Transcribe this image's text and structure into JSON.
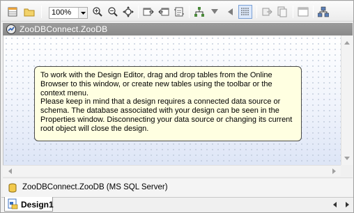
{
  "toolbar": {
    "zoom_value": "100%",
    "buttons": [
      "new-table-icon",
      "new-folder-icon",
      "zoom-in-icon",
      "zoom-out-icon",
      "fit-to-window-icon",
      "insert-table-icon",
      "remove-table-icon",
      "refresh-layout-icon",
      "hierarchy-icon",
      "arrow-down-icon",
      "arrow-left-icon",
      "grid-icon",
      "export-icon",
      "document-icon",
      "window-icon",
      "network-icon"
    ]
  },
  "title_bar": {
    "title": "ZooDBConnect.ZooDB"
  },
  "canvas": {
    "info_text": "To work with the Design Editor, drag and drop tables from the Online Browser to this window, or create new tables using the toolbar or the context menu.\nPlease keep in mind that a design requires a connected data source or schema. The database associated with your design can be seen in the Properties window. Disconnecting your data source or changing its current root object will close the design."
  },
  "status": {
    "datasource_label": "ZooDBConnect.ZooDB (MS SQL Server)"
  },
  "tabs": [
    {
      "label": "Design1",
      "active": true
    }
  ],
  "colors": {
    "titlebar": "#8f8f8f",
    "info_background": "#ffffe1",
    "canvas_gradient_bottom": "#dde5f6"
  }
}
